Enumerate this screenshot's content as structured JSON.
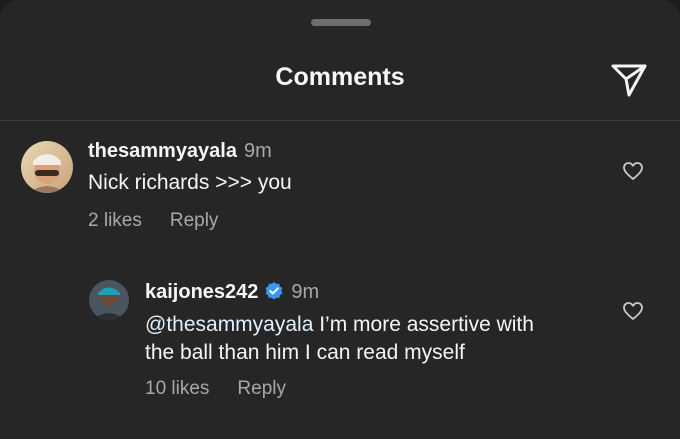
{
  "header": {
    "title": "Comments"
  },
  "icons": {
    "send": "send-paper-plane-icon",
    "like": "heart-outline-icon",
    "verified": "verified-badge-icon"
  },
  "colors": {
    "background": "#262626",
    "text": "#f5f5f5",
    "muted": "#a8a8a8",
    "verified": "#3897f0",
    "mention": "#e0f1ff"
  },
  "comments": [
    {
      "username": "thesammyayala",
      "time": "9m",
      "text": "Nick richards >>> you",
      "likes": "2 likes",
      "reply": "Reply"
    }
  ],
  "replies": [
    {
      "username": "kaijones242",
      "verified": true,
      "time": "9m",
      "mention": "@thesammyayala",
      "text_line1": " I’m more assertive with",
      "text_line2": "the ball than him I can read myself",
      "likes": "10 likes",
      "reply": "Reply"
    }
  ]
}
